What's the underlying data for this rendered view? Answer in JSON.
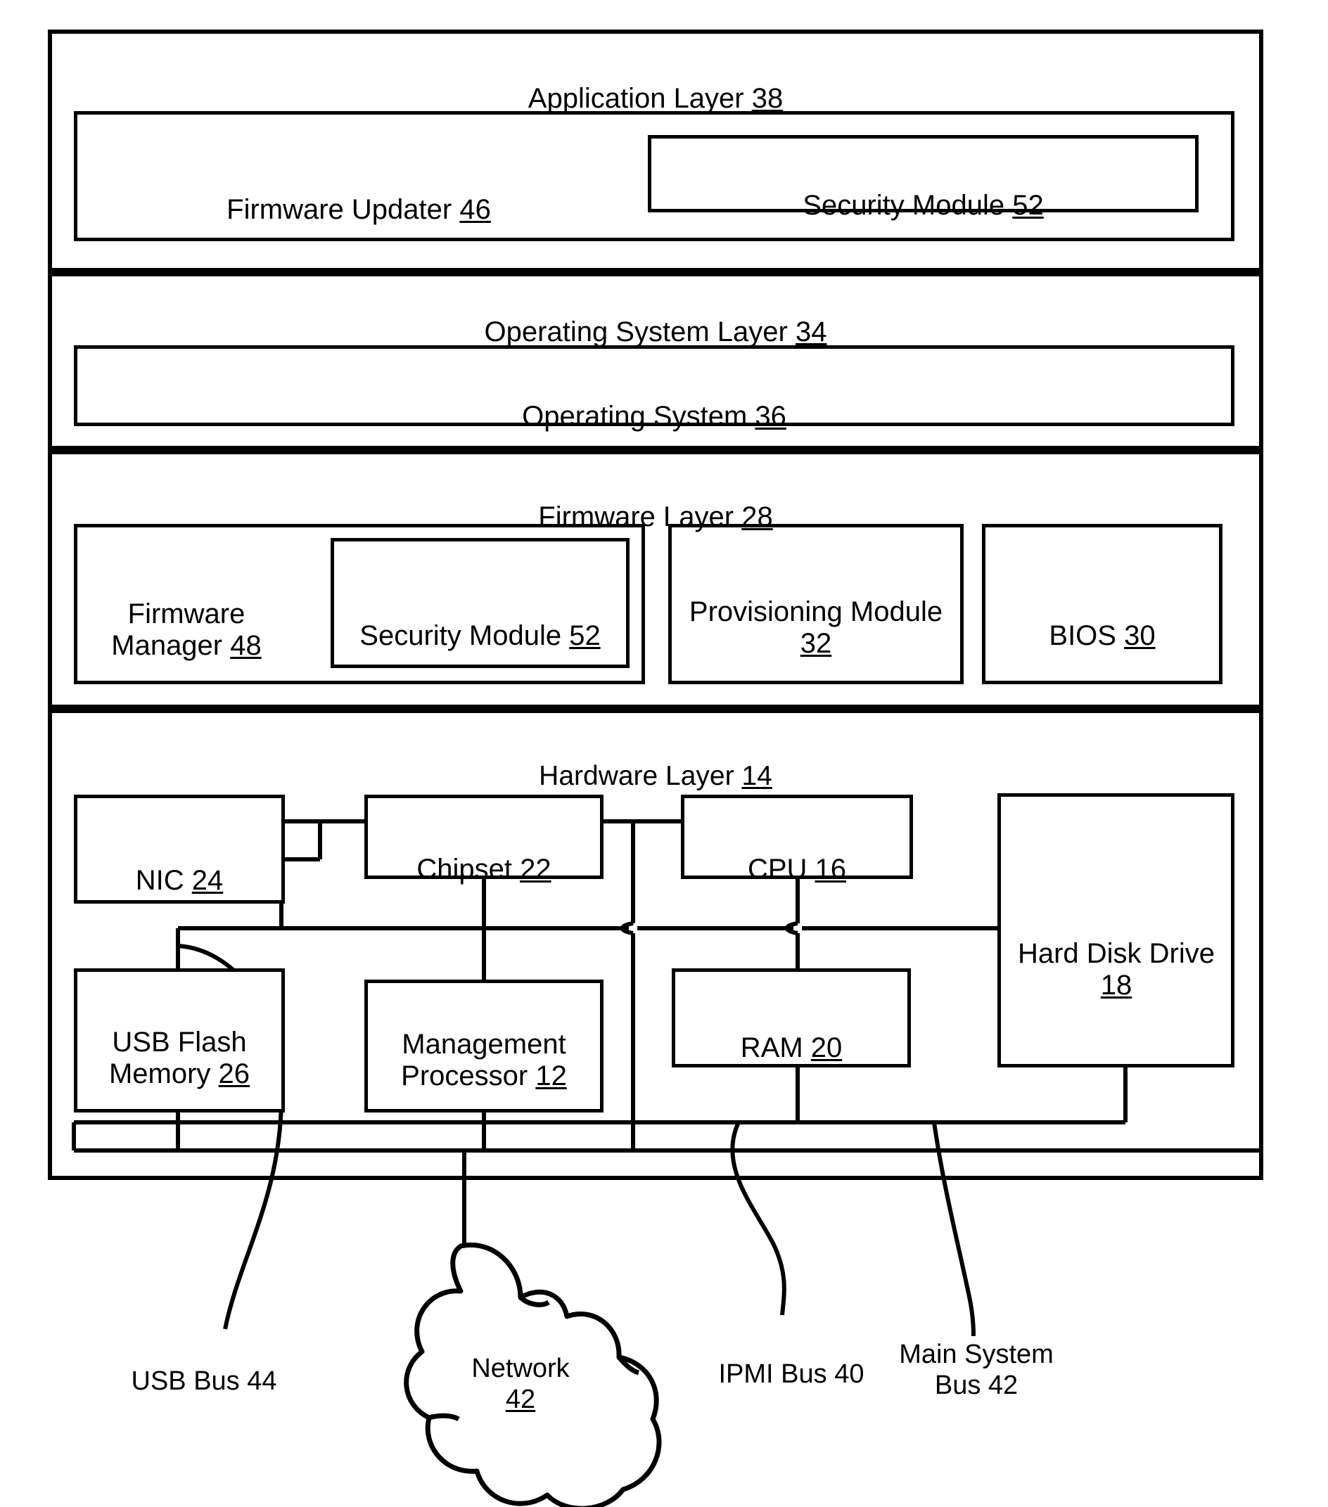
{
  "figure": {
    "type": "patent-block-diagram",
    "background": "#ffffff",
    "line_color": "#000000"
  },
  "layers": [
    {
      "id": "application-layer",
      "title": "Application Layer ",
      "ref": "38",
      "children": [
        {
          "id": "firmware-updater",
          "title": "Firmware Updater ",
          "ref": "46"
        },
        {
          "id": "security-module-app",
          "title": "Security Module ",
          "ref": "52"
        }
      ]
    },
    {
      "id": "operating-system-layer",
      "title": "Operating System Layer ",
      "ref": "34",
      "children": [
        {
          "id": "operating-system",
          "title": "Operating System ",
          "ref": "36"
        }
      ]
    },
    {
      "id": "firmware-layer",
      "title": "Firmware Layer ",
      "ref": "28",
      "children": [
        {
          "id": "firmware-manager",
          "title": "Firmware\nManager ",
          "ref": "48"
        },
        {
          "id": "security-module-fw",
          "title": "Security Module ",
          "ref": "52"
        },
        {
          "id": "provisioning-module",
          "title": "Provisioning Module\n",
          "ref": "32"
        },
        {
          "id": "bios",
          "title": "BIOS ",
          "ref": "30"
        }
      ]
    },
    {
      "id": "hardware-layer",
      "title": "Hardware Layer ",
      "ref": "14",
      "children": [
        {
          "id": "nic",
          "title": "NIC ",
          "ref": "24"
        },
        {
          "id": "chipset",
          "title": "Chipset ",
          "ref": "22"
        },
        {
          "id": "cpu",
          "title": "CPU ",
          "ref": "16"
        },
        {
          "id": "hard-disk-drive",
          "title": "Hard Disk Drive\n",
          "ref": "18"
        },
        {
          "id": "usb-flash-memory",
          "title": "USB Flash\nMemory ",
          "ref": "26"
        },
        {
          "id": "management-processor",
          "title": "Management\nProcessor ",
          "ref": "12"
        },
        {
          "id": "ram",
          "title": "RAM ",
          "ref": "20"
        }
      ]
    }
  ],
  "external": {
    "network_cloud": {
      "title": "Network\n",
      "ref": "42"
    }
  },
  "bus_labels": [
    {
      "id": "usb-bus",
      "text": "USB Bus 44"
    },
    {
      "id": "ipmi-bus",
      "text": "IPMI Bus 40"
    },
    {
      "id": "main-system-bus",
      "text": "Main System\nBus 42"
    }
  ]
}
